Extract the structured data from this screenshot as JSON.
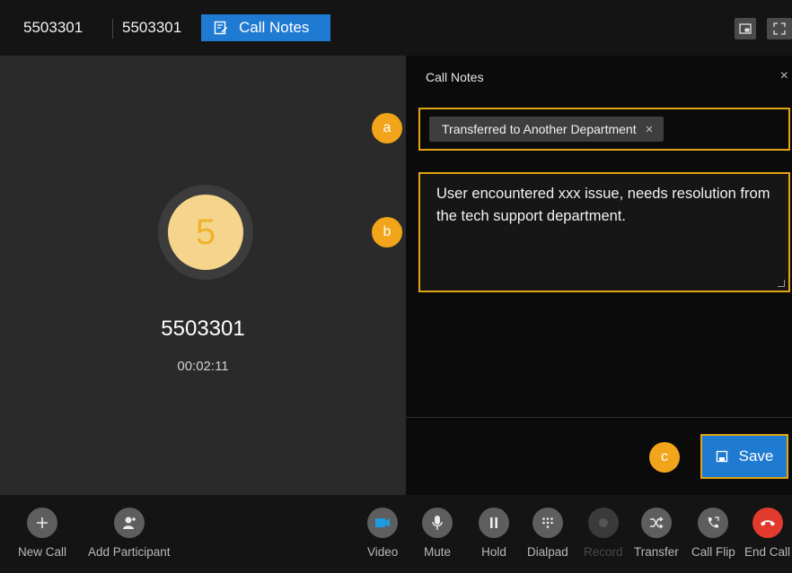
{
  "header": {
    "caller_tab_1": "5503301",
    "caller_tab_2": "5503301",
    "notes_tab_label": "Call Notes"
  },
  "call": {
    "avatar_initial": "5",
    "caller_number": "5503301",
    "duration": "00:02:11"
  },
  "notes_panel": {
    "title": "Call Notes",
    "close_glyph": "×",
    "tags": [
      "Transferred to Another Department"
    ],
    "tag_remove_glyph": "×",
    "note_text": "User encountered xxx issue, needs resolution from the tech support department.",
    "save_label": "Save"
  },
  "markers": {
    "a": "a",
    "b": "b",
    "c": "c"
  },
  "toolbar": {
    "new_call": "New Call",
    "add_participant": "Add Participant",
    "video": "Video",
    "mute": "Mute",
    "hold": "Hold",
    "dialpad": "Dialpad",
    "record": "Record",
    "transfer": "Transfer",
    "call_flip": "Call Flip",
    "end_call": "End Call"
  },
  "colors": {
    "accent_blue": "#1f7ad1",
    "highlight_orange": "#e5a40f",
    "marker_orange": "#f2a51a",
    "avatar_fill": "#f5d58b",
    "end_call_red": "#e23b2e"
  }
}
